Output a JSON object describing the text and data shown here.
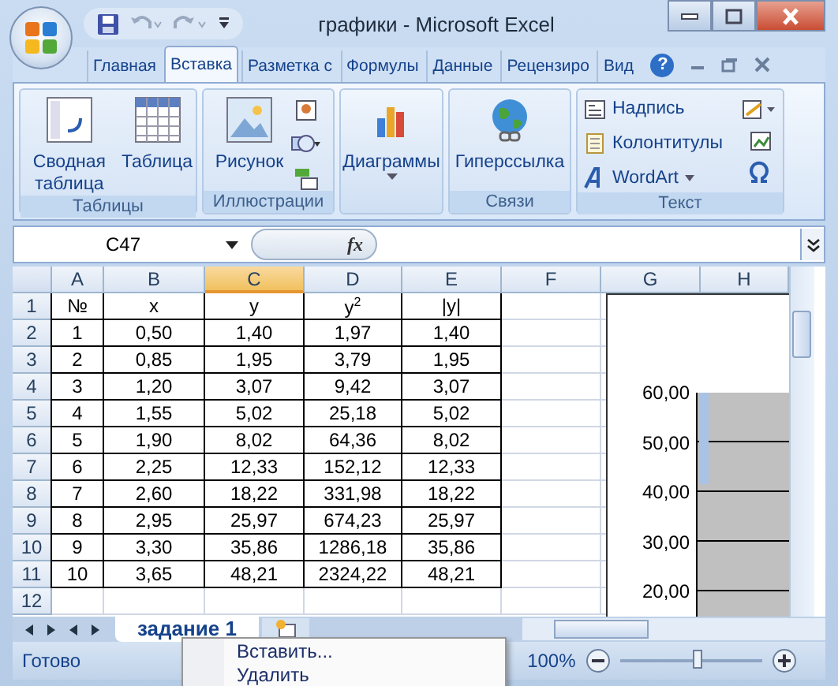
{
  "window": {
    "title": "графики - Microsoft Excel"
  },
  "tabs": [
    {
      "label": "Главная",
      "selected": false
    },
    {
      "label": "Вставка",
      "selected": true
    },
    {
      "label": "Разметка с",
      "selected": false
    },
    {
      "label": "Формулы",
      "selected": false
    },
    {
      "label": "Данные",
      "selected": false
    },
    {
      "label": "Рецензиро",
      "selected": false
    },
    {
      "label": "Вид",
      "selected": false
    }
  ],
  "help": {
    "label": "?"
  },
  "ribbon": {
    "groups": [
      {
        "label": "Таблицы",
        "buttons": [
          "Сводная таблица",
          "Таблица"
        ]
      },
      {
        "label": "Иллюстрации",
        "buttons": [
          "Рисунок"
        ]
      },
      {
        "buttons": [
          "Диаграммы"
        ]
      },
      {
        "label": "Связи",
        "buttons": [
          "Гиперссылка"
        ]
      },
      {
        "label": "Текст",
        "buttons": [
          "Надпись",
          "Колонтитулы",
          "WordArt"
        ]
      }
    ]
  },
  "name_box": {
    "value": "C47"
  },
  "formula_bar": {
    "function_label": "fx"
  },
  "grid": {
    "columns": [
      {
        "label": "A",
        "selected": false
      },
      {
        "label": "B",
        "selected": false
      },
      {
        "label": "C",
        "selected": true
      },
      {
        "label": "D",
        "selected": false
      },
      {
        "label": "E",
        "selected": false
      },
      {
        "label": "F",
        "selected": false
      },
      {
        "label": "G",
        "selected": false
      },
      {
        "label": "H",
        "selected": false
      }
    ],
    "rows": [
      {
        "number": "1",
        "cells": [
          "№",
          "x",
          "y",
          "y$^{2}$",
          "|y|"
        ]
      },
      {
        "number": "2",
        "cells": [
          "1",
          "0,50",
          "1,40",
          "1,97",
          "1,40"
        ]
      },
      {
        "number": "3",
        "cells": [
          "2",
          "0,85",
          "1,95",
          "3,79",
          "1,95"
        ]
      },
      {
        "number": "4",
        "cells": [
          "3",
          "1,20",
          "3,07",
          "9,42",
          "3,07"
        ]
      },
      {
        "number": "5",
        "cells": [
          "4",
          "1,55",
          "5,02",
          "25,18",
          "5,02"
        ]
      },
      {
        "number": "6",
        "cells": [
          "5",
          "1,90",
          "8,02",
          "64,36",
          "8,02"
        ]
      },
      {
        "number": "7",
        "cells": [
          "6",
          "2,25",
          "12,33",
          "152,12",
          "12,33"
        ]
      },
      {
        "number": "8",
        "cells": [
          "7",
          "2,60",
          "18,22",
          "331,98",
          "18,22"
        ]
      },
      {
        "number": "9",
        "cells": [
          "8",
          "2,95",
          "25,97",
          "674,23",
          "25,97"
        ]
      },
      {
        "number": "10",
        "cells": [
          "9",
          "3,30",
          "35,86",
          "1286,18",
          "35,86"
        ]
      },
      {
        "number": "11",
        "cells": [
          "10",
          "3,65",
          "48,21",
          "2324,22",
          "48,21"
        ]
      },
      {
        "number": "12",
        "cells": []
      }
    ]
  },
  "chart": {
    "axis_labels": [
      "60,00",
      "50,00",
      "40,00",
      "30,00",
      "20,00"
    ]
  },
  "sheet_tabs": [
    {
      "label": "задание 1",
      "selected": true
    }
  ],
  "status_bar": {
    "status": "Готово",
    "zoom": "100%",
    "zoom_slider": {
      "level": 0.55
    }
  },
  "context_menu": {
    "items": [
      "Вставить...",
      "Удалить"
    ]
  }
}
